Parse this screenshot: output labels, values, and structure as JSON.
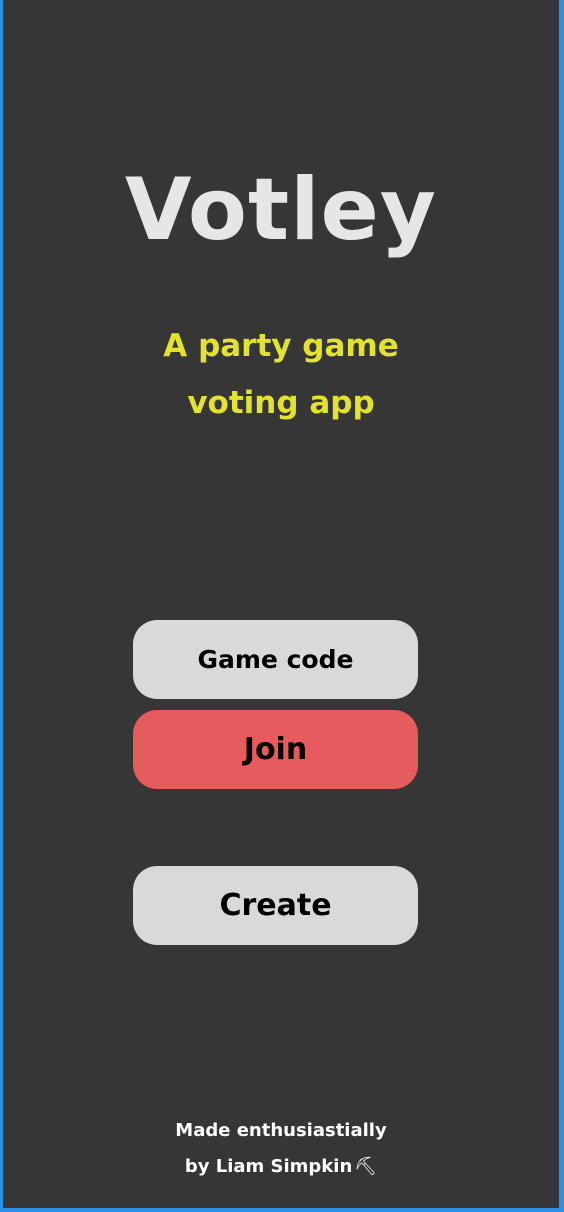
{
  "app": {
    "title": "Votley",
    "subtitle_line1": "A party game",
    "subtitle_line2": "voting app"
  },
  "form": {
    "game_code_placeholder": "Game code",
    "join_label": "Join",
    "create_label": "Create"
  },
  "footer": {
    "line1": "Made enthusiastially",
    "line2": "by Liam Simpkin",
    "icon": "hammer-icon",
    "icon_glyph": "⛏"
  },
  "colors": {
    "background": "#363636",
    "title": "#e6e6e6",
    "subtitle": "#e3e22c",
    "pill": "#d9d9d9",
    "join": "#e65b5c",
    "frame": "#2b8fe6"
  }
}
